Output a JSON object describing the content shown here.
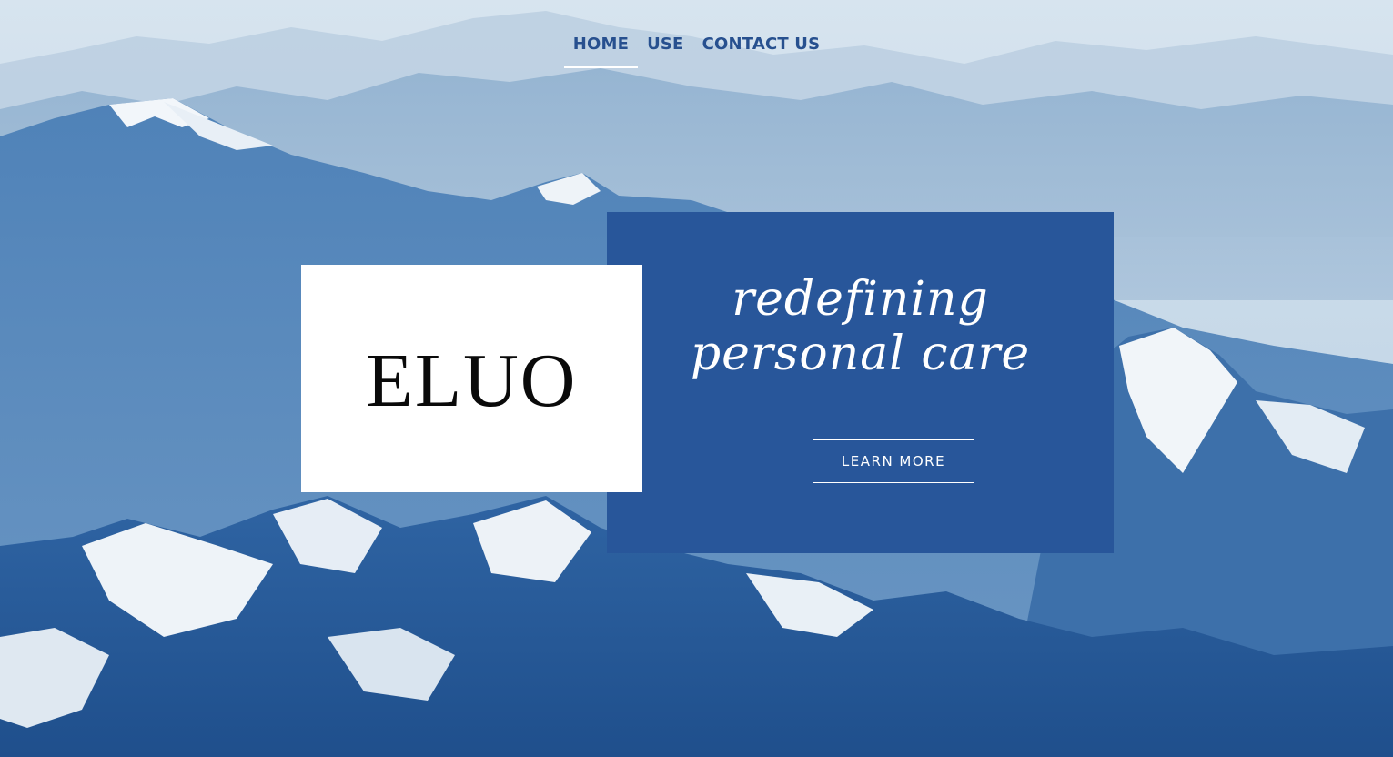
{
  "nav": {
    "items": [
      {
        "label": "HOME",
        "active": true
      },
      {
        "label": "USE",
        "active": false
      },
      {
        "label": "CONTACT US",
        "active": false
      }
    ]
  },
  "hero": {
    "logo": "ELUO",
    "tagline_line1": "redefining",
    "tagline_line2": "personal care",
    "cta_label": "LEARN MORE",
    "background_image": "snowy-mountain-range-photo"
  },
  "colors": {
    "brand_blue": "#28569a",
    "nav_text": "#27508f",
    "logo_bg": "#ffffff"
  }
}
